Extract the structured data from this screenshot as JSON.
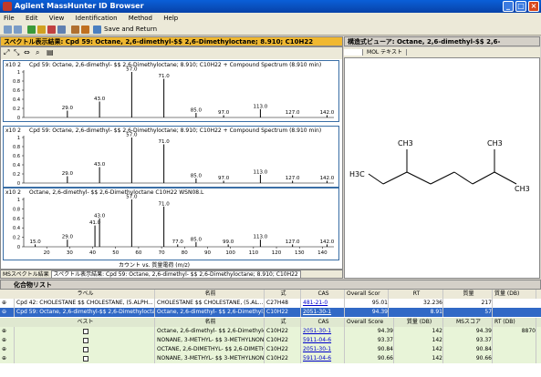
{
  "window": {
    "title": "Agilent MassHunter ID Browser"
  },
  "menu": [
    "File",
    "Edit",
    "View",
    "Identification",
    "Method",
    "Help"
  ],
  "toolbar": {
    "save_return": "Save and Return"
  },
  "spectrum_pane": {
    "title": "スペクトル表示結果: Cpd 59: Octane, 2,6-dimethyl-$$ 2,6-Dimethyloctane; 8.910; C10H22",
    "caption_prefix": "MSスペクトル結果",
    "caption_tab": "スペクトル表示結果: Cpd 59: Octane, 2,6-dimethyl- $$ 2,6-Dimethyloctane; 8.910; C10H22",
    "xaxis_label": "カウント vs. 質量電荷 (m/z)",
    "plots": [
      {
        "title": "Cpd 59: Octane, 2,6-dimethyl- $$ 2,6-Dimethyloctane; 8.910; C10H22 + Compound Spectrum (8.910 min)",
        "scale": "x10 2"
      },
      {
        "title": "Cpd 59: Octane, 2,6-dimethyl- $$ 2,6-Dimethyloctane; 8.910; C10H22 + Compound Spectrum (8.910 min)",
        "scale": "x10 2"
      },
      {
        "title": "Octane, 2,6-dimethyl- $$ 2,6-Dimethyloctane C10H22 WSN08.L",
        "scale": "x10 2"
      }
    ],
    "y_ticks": [
      "1",
      "0.8",
      "0.6",
      "0.4",
      "0.2",
      "0"
    ]
  },
  "chart_data": [
    {
      "type": "bar",
      "title": "Cpd 59: Octane, 2,6-dimethyl- $$ 2,6-Dimethyloctane; 8.910; C10H22 + Compound Spectrum (8.910 min)",
      "x": [
        29.0,
        43.0,
        57.0,
        71.0,
        85.0,
        97.0,
        113.0,
        127.0,
        142.0
      ],
      "values": [
        0.15,
        0.35,
        1.0,
        0.85,
        0.1,
        0.05,
        0.18,
        0.05,
        0.05
      ],
      "xlim": [
        10,
        145
      ],
      "ylim": [
        0,
        1
      ]
    },
    {
      "type": "bar",
      "title": "Cpd 59: Octane, 2,6-dimethyl- $$ 2,6-Dimethyloctane; 8.910; C10H22 + Compound Spectrum (8.910 min)",
      "x": [
        29.0,
        43.0,
        57.0,
        71.0,
        85.0,
        97.0,
        113.0,
        127.0,
        142.0
      ],
      "values": [
        0.15,
        0.35,
        1.0,
        0.85,
        0.1,
        0.05,
        0.18,
        0.05,
        0.05
      ],
      "xlim": [
        10,
        145
      ],
      "ylim": [
        0,
        1
      ]
    },
    {
      "type": "bar",
      "title": "Octane, 2,6-dimethyl- $$ 2,6-Dimethyloctane C10H22 WSN08.L",
      "x": [
        15.0,
        29.0,
        41.0,
        43.0,
        57.0,
        71.0,
        77.0,
        85.0,
        99.0,
        113.0,
        127.0,
        142.0
      ],
      "values": [
        0.05,
        0.15,
        0.45,
        0.6,
        1.0,
        0.85,
        0.05,
        0.1,
        0.05,
        0.15,
        0.05,
        0.05
      ],
      "xlim": [
        10,
        145
      ],
      "ylim": [
        0,
        1
      ]
    }
  ],
  "x_ticks": [
    "20",
    "30",
    "40",
    "50",
    "60",
    "70",
    "80",
    "90",
    "100",
    "110",
    "120",
    "130",
    "140"
  ],
  "structure_pane": {
    "title": "構造式ビューア: Octane, 2,6-dimethyl-$$ 2,6-Dimethyloctane",
    "tabs": [
      "構造",
      "MOL テキスト"
    ],
    "labels": {
      "ch3_a": "CH3",
      "ch3_b": "CH3",
      "h3c": "H3C",
      "ch3_c": "CH3"
    }
  },
  "compound_list": {
    "title": "化合物リスト",
    "headers": [
      "ラベル",
      "名前",
      "式",
      "CAS",
      "Overall Scor",
      "RT",
      "質量",
      "質量 (DB)"
    ],
    "rows": [
      [
        "Cpd 42: CHOLESTANE $$ CHOLESTANE, (5.ALPH...",
        "CHOLESTANE $$ CHOLESTANE, (5.AL...",
        "C27H48",
        "481-21-0",
        "95.01",
        "32.236",
        "217",
        ""
      ],
      [
        "Cpd 59: Octane, 2,6-dimethyl-$$ 2,6-Dimethyloctan...",
        "Octane, 2,6-dimethyl- $$ 2,6-Dimethyl...",
        "C10H22",
        "2051-30-1",
        "94.39",
        "8.91",
        "57",
        ""
      ]
    ],
    "sub_headers": [
      "ベスト",
      "名前",
      "式",
      "CAS",
      "Overall Score",
      "質量 (DB)",
      "MSスコア",
      "RT (DB)"
    ],
    "sub_rows": [
      [
        "Octane, 2,6-dimethyl- $$ 2,6-Dimethylocta...",
        "C10H22",
        "2051-30-1",
        "94.39",
        "142",
        "94.39",
        "8870"
      ],
      [
        "NONANE, 3-METHYL- $$ 3-METHYLNONA...",
        "C10H22",
        "5911-04-6",
        "93.37",
        "142",
        "93.37",
        ""
      ],
      [
        "OCTANE, 2,6-DIMETHYL- $$ 2,6-DIMETH...",
        "C10H22",
        "2051-30-1",
        "90.84",
        "142",
        "90.84",
        ""
      ],
      [
        "NONANE, 3-METHYL- $$ 3-METHYLNONA...",
        "C10H22",
        "5911-04-6",
        "90.66",
        "142",
        "90.66",
        ""
      ]
    ]
  }
}
